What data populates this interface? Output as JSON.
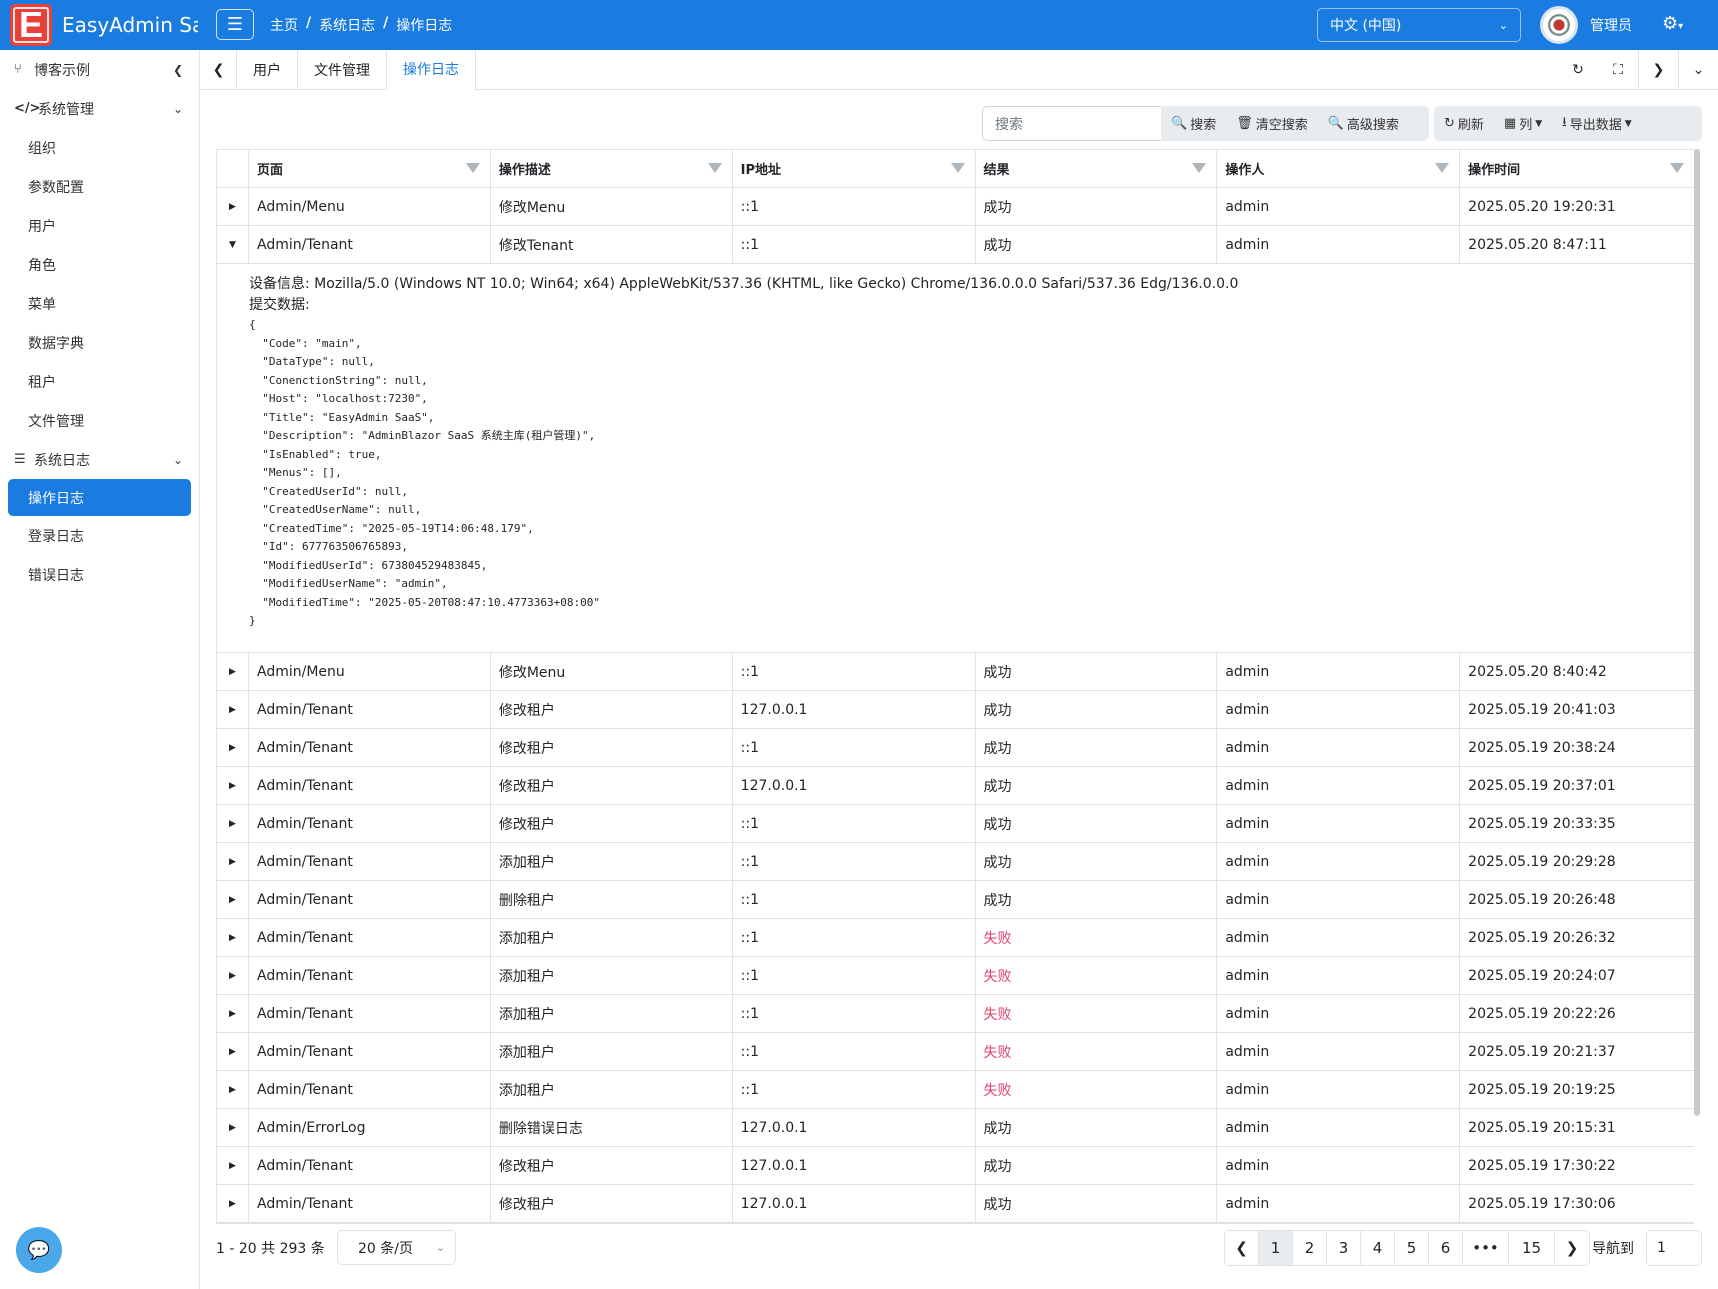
{
  "header": {
    "logo_letter": "E",
    "app_title": "EasyAdmin Saa",
    "breadcrumb": [
      "主页",
      "/",
      "系统日志",
      "/",
      "操作日志"
    ],
    "language": "中文 (中国)",
    "user_name": "管理员",
    "brand_color": "#1a7be0"
  },
  "sidebar": {
    "items": [
      {
        "label": "博客示例",
        "icon": "branch-icon"
      },
      {
        "label": "系统管理",
        "icon": "code-icon"
      },
      {
        "label": "组织"
      },
      {
        "label": "参数配置"
      },
      {
        "label": "用户"
      },
      {
        "label": "角色"
      },
      {
        "label": "菜单"
      },
      {
        "label": "数据字典"
      },
      {
        "label": "租户"
      },
      {
        "label": "文件管理"
      },
      {
        "label": "系统日志",
        "icon": "server-icon"
      },
      {
        "label": "操作日志",
        "active": true
      },
      {
        "label": "登录日志"
      },
      {
        "label": "错误日志"
      }
    ]
  },
  "tabs": [
    {
      "label": "用户"
    },
    {
      "label": "文件管理"
    },
    {
      "label": "操作日志",
      "active": true
    }
  ],
  "toolbar": {
    "search_placeholder": "搜索",
    "search": "搜索",
    "clear_search": "清空搜索",
    "advanced_search": "高级搜索",
    "refresh": "刷新",
    "columns": "列",
    "export": "导出数据"
  },
  "table": {
    "headers": [
      "页面",
      "操作描述",
      "IP地址",
      "结果",
      "操作人",
      "操作时间"
    ],
    "rows": [
      {
        "page": "Admin/Menu",
        "desc": "修改Menu",
        "ip": "::1",
        "result": "成功",
        "user": "admin",
        "time": "2025.05.20 19:20:31"
      },
      {
        "page": "Admin/Tenant",
        "desc": "修改Tenant",
        "ip": "::1",
        "result": "成功",
        "user": "admin",
        "time": "2025.05.20 8:47:11",
        "expanded": true
      },
      {
        "page": "Admin/Menu",
        "desc": "修改Menu",
        "ip": "::1",
        "result": "成功",
        "user": "admin",
        "time": "2025.05.20 8:40:42"
      },
      {
        "page": "Admin/Tenant",
        "desc": "修改租户",
        "ip": "127.0.0.1",
        "result": "成功",
        "user": "admin",
        "time": "2025.05.19 20:41:03"
      },
      {
        "page": "Admin/Tenant",
        "desc": "修改租户",
        "ip": "::1",
        "result": "成功",
        "user": "admin",
        "time": "2025.05.19 20:38:24"
      },
      {
        "page": "Admin/Tenant",
        "desc": "修改租户",
        "ip": "127.0.0.1",
        "result": "成功",
        "user": "admin",
        "time": "2025.05.19 20:37:01"
      },
      {
        "page": "Admin/Tenant",
        "desc": "修改租户",
        "ip": "::1",
        "result": "成功",
        "user": "admin",
        "time": "2025.05.19 20:33:35"
      },
      {
        "page": "Admin/Tenant",
        "desc": "添加租户",
        "ip": "::1",
        "result": "成功",
        "user": "admin",
        "time": "2025.05.19 20:29:28"
      },
      {
        "page": "Admin/Tenant",
        "desc": "删除租户",
        "ip": "::1",
        "result": "成功",
        "user": "admin",
        "time": "2025.05.19 20:26:48"
      },
      {
        "page": "Admin/Tenant",
        "desc": "添加租户",
        "ip": "::1",
        "result": "失败",
        "user": "admin",
        "time": "2025.05.19 20:26:32"
      },
      {
        "page": "Admin/Tenant",
        "desc": "添加租户",
        "ip": "::1",
        "result": "失败",
        "user": "admin",
        "time": "2025.05.19 20:24:07"
      },
      {
        "page": "Admin/Tenant",
        "desc": "添加租户",
        "ip": "::1",
        "result": "失败",
        "user": "admin",
        "time": "2025.05.19 20:22:26"
      },
      {
        "page": "Admin/Tenant",
        "desc": "添加租户",
        "ip": "::1",
        "result": "失败",
        "user": "admin",
        "time": "2025.05.19 20:21:37"
      },
      {
        "page": "Admin/Tenant",
        "desc": "添加租户",
        "ip": "::1",
        "result": "失败",
        "user": "admin",
        "time": "2025.05.19 20:19:25"
      },
      {
        "page": "Admin/ErrorLog",
        "desc": "删除错误日志",
        "ip": "127.0.0.1",
        "result": "成功",
        "user": "admin",
        "time": "2025.05.19 20:15:31"
      },
      {
        "page": "Admin/Tenant",
        "desc": "修改租户",
        "ip": "127.0.0.1",
        "result": "成功",
        "user": "admin",
        "time": "2025.05.19 17:30:22"
      },
      {
        "page": "Admin/Tenant",
        "desc": "修改租户",
        "ip": "127.0.0.1",
        "result": "成功",
        "user": "admin",
        "time": "2025.05.19 17:30:06"
      }
    ],
    "detail": {
      "device_label": "设备信息:",
      "device_value": "Mozilla/5.0 (Windows NT 10.0; Win64; x64) AppleWebKit/537.36 (KHTML, like Gecko) Chrome/136.0.0.0 Safari/537.36 Edg/136.0.0.0",
      "submit_label": "提交数据:",
      "json": "{\n  \"Code\": \"main\",\n  \"DataType\": null,\n  \"ConenctionString\": null,\n  \"Host\": \"localhost:7230\",\n  \"Title\": \"EasyAdmin SaaS\",\n  \"Description\": \"AdminBlazor SaaS 系统主库(租户管理)\",\n  \"IsEnabled\": true,\n  \"Menus\": [],\n  \"CreatedUserId\": null,\n  \"CreatedUserName\": null,\n  \"CreatedTime\": \"2025-05-19T14:06:48.179\",\n  \"Id\": 677763506765893,\n  \"ModifiedUserId\": 673804529483845,\n  \"ModifiedUserName\": \"admin\",\n  \"ModifiedTime\": \"2025-05-20T08:47:10.4773363+08:00\"\n}"
    }
  },
  "footer": {
    "page_info": "1 - 20 共 293 条",
    "page_size": "20 条/页",
    "pages": [
      "1",
      "2",
      "3",
      "4",
      "5",
      "6",
      "•••",
      "15"
    ],
    "current_page": "1",
    "goto_label": "导航到",
    "goto_value": "1"
  }
}
